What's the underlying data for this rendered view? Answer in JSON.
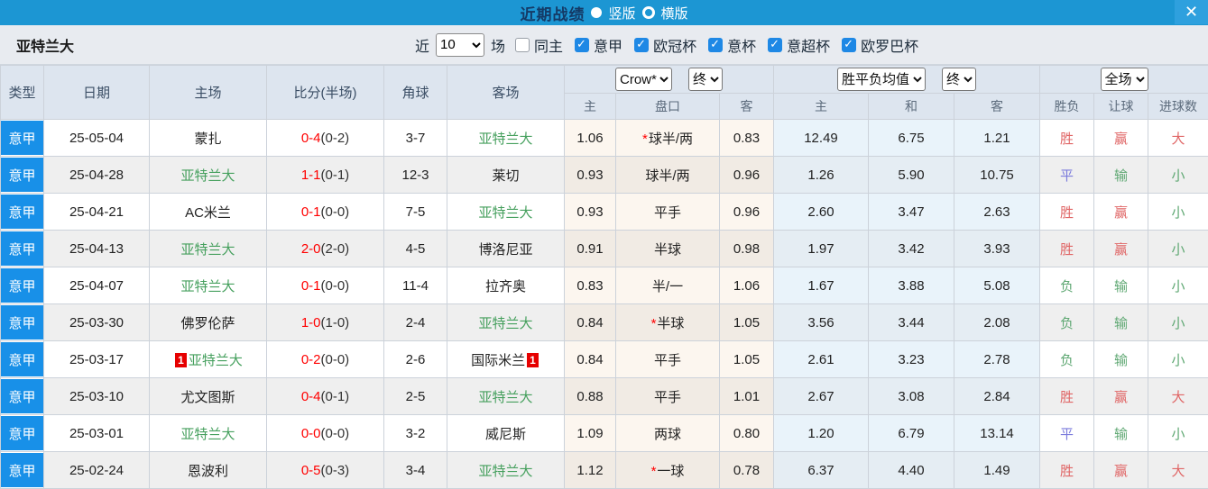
{
  "colors": {
    "accent": "#1c96d3",
    "league_cell": "#1890e8",
    "focus_team": "#46a05e",
    "score": "#ff0000",
    "win": "#e06666",
    "draw": "#7b7bdc",
    "lose": "#5fa873"
  },
  "titlebar": {
    "title": "近期战绩",
    "portrait_label": "竖版",
    "landscape_label": "横版",
    "close_glyph": "✕"
  },
  "filter": {
    "team": "亚特兰大",
    "near_label": "近",
    "games_value": "10",
    "games_label": "场",
    "same_home_label": "同主",
    "leagues": [
      "意甲",
      "欧冠杯",
      "意杯",
      "意超杯",
      "欧罗巴杯"
    ]
  },
  "header": {
    "type": "类型",
    "date": "日期",
    "home": "主场",
    "score": "比分(半场)",
    "corner": "角球",
    "away": "客场",
    "bookmaker_select": "Crow*",
    "odds_time_select": "终",
    "avg_select": "胜平负均值",
    "avg_time_select": "终",
    "period_select": "全场",
    "sub": [
      "主",
      "盘口",
      "客",
      "主",
      "和",
      "客",
      "胜负",
      "让球",
      "进球数"
    ]
  },
  "rows": [
    {
      "league": "意甲",
      "date": "25-05-04",
      "home": {
        "name": "蒙扎",
        "focus": false
      },
      "score": {
        "full": "0-4",
        "half": "(0-2)"
      },
      "corner": "3-7",
      "away": {
        "name": "亚特兰大",
        "focus": true
      },
      "odds_home": "1.06",
      "handicap": {
        "text": "球半/两",
        "star": true
      },
      "odds_away": "0.83",
      "avg_home": "12.49",
      "avg_draw": "6.75",
      "avg_away": "1.21",
      "result": {
        "text": "胜",
        "color": "red"
      },
      "handicap_result": {
        "text": "赢",
        "color": "red"
      },
      "goals": {
        "text": "大",
        "color": "red"
      }
    },
    {
      "league": "意甲",
      "date": "25-04-28",
      "home": {
        "name": "亚特兰大",
        "focus": true
      },
      "score": {
        "full": "1-1",
        "half": "(0-1)"
      },
      "corner": "12-3",
      "away": {
        "name": "莱切",
        "focus": false
      },
      "odds_home": "0.93",
      "handicap": {
        "text": "球半/两",
        "star": false
      },
      "odds_away": "0.96",
      "avg_home": "1.26",
      "avg_draw": "5.90",
      "avg_away": "10.75",
      "result": {
        "text": "平",
        "color": "blue"
      },
      "handicap_result": {
        "text": "输",
        "color": "green"
      },
      "goals": {
        "text": "小",
        "color": "green"
      }
    },
    {
      "league": "意甲",
      "date": "25-04-21",
      "home": {
        "name": "AC米兰",
        "focus": false
      },
      "score": {
        "full": "0-1",
        "half": "(0-0)"
      },
      "corner": "7-5",
      "away": {
        "name": "亚特兰大",
        "focus": true
      },
      "odds_home": "0.93",
      "handicap": {
        "text": "平手",
        "star": false
      },
      "odds_away": "0.96",
      "avg_home": "2.60",
      "avg_draw": "3.47",
      "avg_away": "2.63",
      "result": {
        "text": "胜",
        "color": "red"
      },
      "handicap_result": {
        "text": "赢",
        "color": "red"
      },
      "goals": {
        "text": "小",
        "color": "green"
      }
    },
    {
      "league": "意甲",
      "date": "25-04-13",
      "home": {
        "name": "亚特兰大",
        "focus": true
      },
      "score": {
        "full": "2-0",
        "half": "(2-0)"
      },
      "corner": "4-5",
      "away": {
        "name": "博洛尼亚",
        "focus": false
      },
      "odds_home": "0.91",
      "handicap": {
        "text": "半球",
        "star": false
      },
      "odds_away": "0.98",
      "avg_home": "1.97",
      "avg_draw": "3.42",
      "avg_away": "3.93",
      "result": {
        "text": "胜",
        "color": "red"
      },
      "handicap_result": {
        "text": "赢",
        "color": "red"
      },
      "goals": {
        "text": "小",
        "color": "green"
      }
    },
    {
      "league": "意甲",
      "date": "25-04-07",
      "home": {
        "name": "亚特兰大",
        "focus": true
      },
      "score": {
        "full": "0-1",
        "half": "(0-0)"
      },
      "corner": "11-4",
      "away": {
        "name": "拉齐奥",
        "focus": false
      },
      "odds_home": "0.83",
      "handicap": {
        "text": "半/一",
        "star": false
      },
      "odds_away": "1.06",
      "avg_home": "1.67",
      "avg_draw": "3.88",
      "avg_away": "5.08",
      "result": {
        "text": "负",
        "color": "green"
      },
      "handicap_result": {
        "text": "输",
        "color": "green"
      },
      "goals": {
        "text": "小",
        "color": "green"
      }
    },
    {
      "league": "意甲",
      "date": "25-03-30",
      "home": {
        "name": "佛罗伦萨",
        "focus": false
      },
      "score": {
        "full": "1-0",
        "half": "(1-0)"
      },
      "corner": "2-4",
      "away": {
        "name": "亚特兰大",
        "focus": true
      },
      "odds_home": "0.84",
      "handicap": {
        "text": "半球",
        "star": true
      },
      "odds_away": "1.05",
      "avg_home": "3.56",
      "avg_draw": "3.44",
      "avg_away": "2.08",
      "result": {
        "text": "负",
        "color": "green"
      },
      "handicap_result": {
        "text": "输",
        "color": "green"
      },
      "goals": {
        "text": "小",
        "color": "green"
      }
    },
    {
      "league": "意甲",
      "date": "25-03-17",
      "home": {
        "name": "亚特兰大",
        "focus": true,
        "badge": "1",
        "badge_pos": "before"
      },
      "score": {
        "full": "0-2",
        "half": "(0-0)"
      },
      "corner": "2-6",
      "away": {
        "name": "国际米兰",
        "focus": false,
        "badge": "1",
        "badge_pos": "after"
      },
      "odds_home": "0.84",
      "handicap": {
        "text": "平手",
        "star": false
      },
      "odds_away": "1.05",
      "avg_home": "2.61",
      "avg_draw": "3.23",
      "avg_away": "2.78",
      "result": {
        "text": "负",
        "color": "green"
      },
      "handicap_result": {
        "text": "输",
        "color": "green"
      },
      "goals": {
        "text": "小",
        "color": "green"
      }
    },
    {
      "league": "意甲",
      "date": "25-03-10",
      "home": {
        "name": "尤文图斯",
        "focus": false
      },
      "score": {
        "full": "0-4",
        "half": "(0-1)"
      },
      "corner": "2-5",
      "away": {
        "name": "亚特兰大",
        "focus": true
      },
      "odds_home": "0.88",
      "handicap": {
        "text": "平手",
        "star": false
      },
      "odds_away": "1.01",
      "avg_home": "2.67",
      "avg_draw": "3.08",
      "avg_away": "2.84",
      "result": {
        "text": "胜",
        "color": "red"
      },
      "handicap_result": {
        "text": "赢",
        "color": "red"
      },
      "goals": {
        "text": "大",
        "color": "red"
      }
    },
    {
      "league": "意甲",
      "date": "25-03-01",
      "home": {
        "name": "亚特兰大",
        "focus": true
      },
      "score": {
        "full": "0-0",
        "half": "(0-0)"
      },
      "corner": "3-2",
      "away": {
        "name": "威尼斯",
        "focus": false
      },
      "odds_home": "1.09",
      "handicap": {
        "text": "两球",
        "star": false
      },
      "odds_away": "0.80",
      "avg_home": "1.20",
      "avg_draw": "6.79",
      "avg_away": "13.14",
      "result": {
        "text": "平",
        "color": "blue"
      },
      "handicap_result": {
        "text": "输",
        "color": "green"
      },
      "goals": {
        "text": "小",
        "color": "green"
      }
    },
    {
      "league": "意甲",
      "date": "25-02-24",
      "home": {
        "name": "恩波利",
        "focus": false
      },
      "score": {
        "full": "0-5",
        "half": "(0-3)"
      },
      "corner": "3-4",
      "away": {
        "name": "亚特兰大",
        "focus": true
      },
      "odds_home": "1.12",
      "handicap": {
        "text": "一球",
        "star": true
      },
      "odds_away": "0.78",
      "avg_home": "6.37",
      "avg_draw": "4.40",
      "avg_away": "1.49",
      "result": {
        "text": "胜",
        "color": "red"
      },
      "handicap_result": {
        "text": "赢",
        "color": "red"
      },
      "goals": {
        "text": "大",
        "color": "red"
      }
    }
  ]
}
